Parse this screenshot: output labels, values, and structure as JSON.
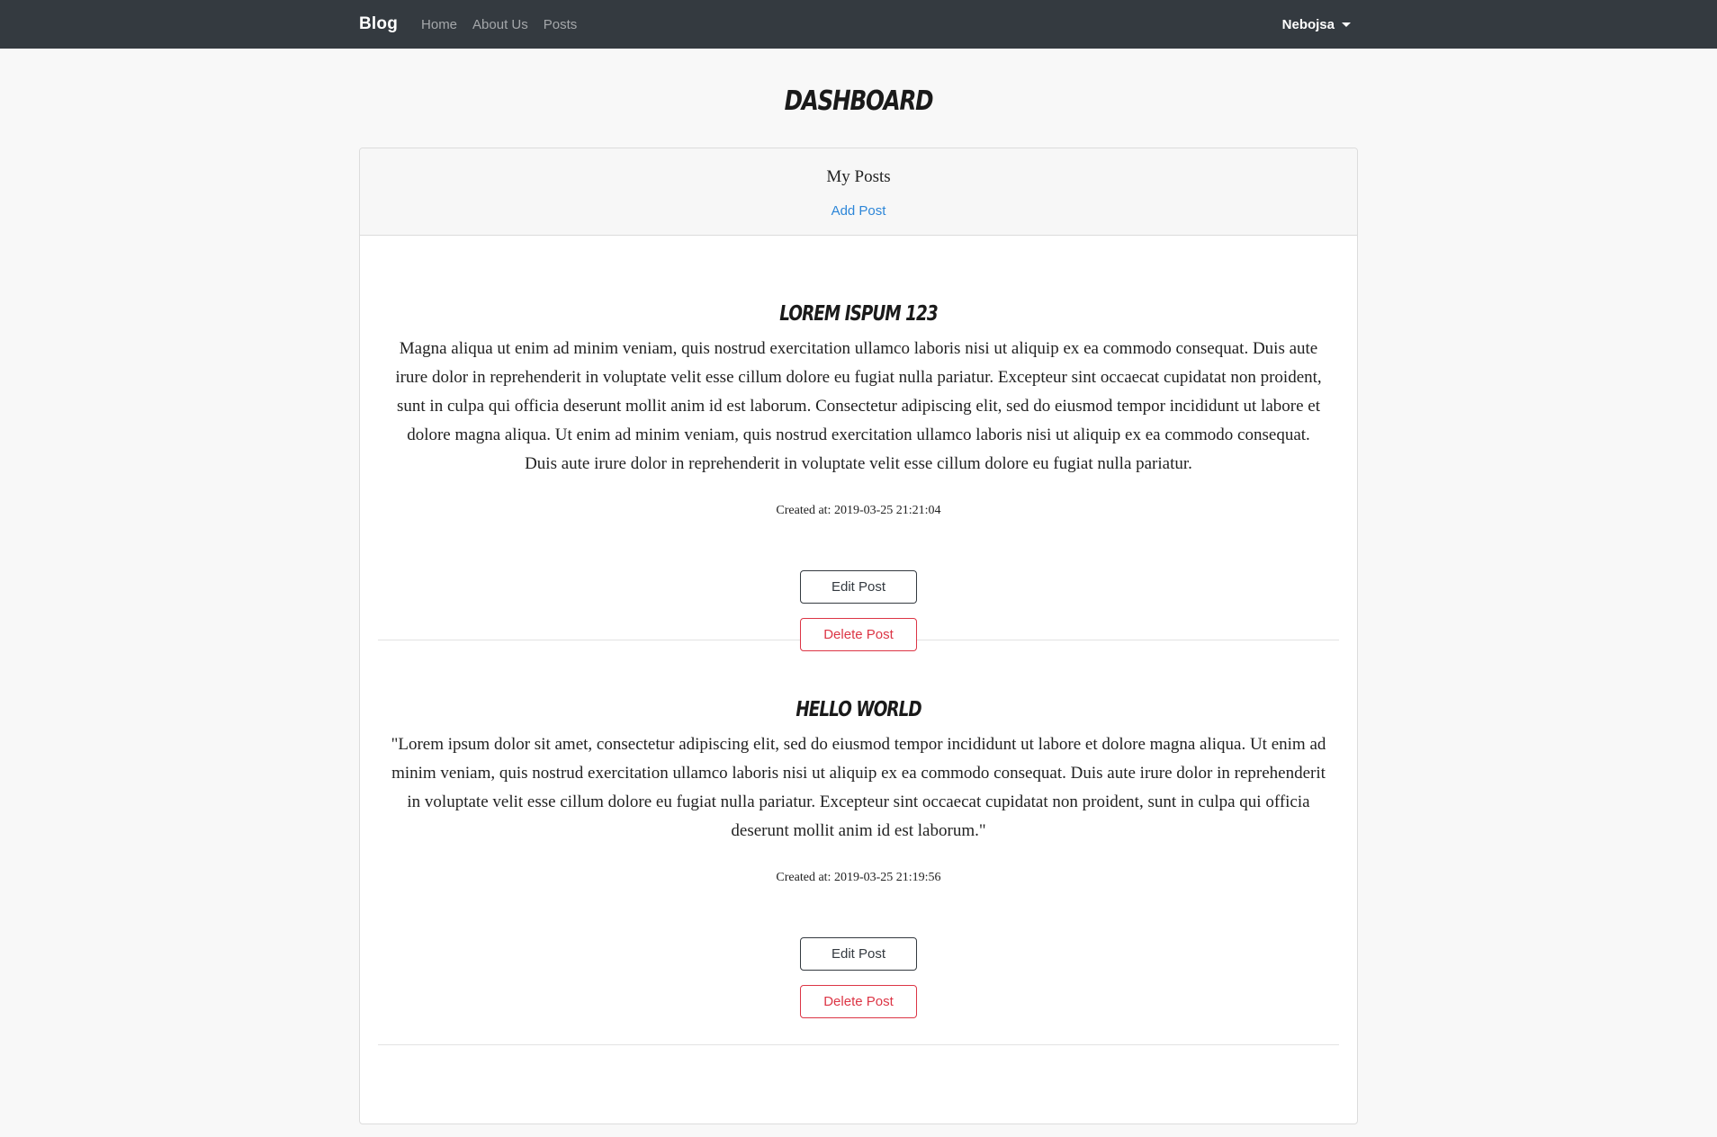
{
  "navbar": {
    "brand": "Blog",
    "links": [
      "Home",
      "About Us",
      "Posts"
    ],
    "user": "Nebojsa"
  },
  "page": {
    "title": "DASHBOARD"
  },
  "card": {
    "title": "My Posts",
    "add_label": "Add Post"
  },
  "posts": [
    {
      "title": "LOREM ISPUM 123",
      "body": "Magna aliqua ut enim ad minim veniam, quis nostrud exercitation ullamco laboris nisi ut aliquip ex ea commodo consequat. Duis aute irure dolor in reprehenderit in voluptate velit esse cillum dolore eu fugiat nulla pariatur. Excepteur sint occaecat cupidatat non proident, sunt in culpa qui officia deserunt mollit anim id est laborum. Consectetur adipiscing elit, sed do eiusmod tempor incididunt ut labore et dolore magna aliqua. Ut enim ad minim veniam, quis nostrud exercitation ullamco laboris nisi ut aliquip ex ea commodo consequat. Duis aute irure dolor in reprehenderit in voluptate velit esse cillum dolore eu fugiat nulla pariatur.",
      "created": "Created at: 2019-03-25 21:21:04",
      "edit_label": "Edit Post",
      "delete_label": "Delete Post"
    },
    {
      "title": "HELLO WORLD",
      "body": "\"Lorem ipsum dolor sit amet, consectetur adipiscing elit, sed do eiusmod tempor incididunt ut labore et dolore magna aliqua. Ut enim ad minim veniam, quis nostrud exercitation ullamco laboris nisi ut aliquip ex ea commodo consequat. Duis aute irure dolor in reprehenderit in voluptate velit esse cillum dolore eu fugiat nulla pariatur. Excepteur sint occaecat cupidatat non proident, sunt in culpa qui officia deserunt mollit anim id est laborum.\"",
      "created": "Created at: 2019-03-25 21:19:56",
      "edit_label": "Edit Post",
      "delete_label": "Delete Post"
    }
  ],
  "colors": {
    "navbar_bg": "#343a40",
    "link_blue": "#2d86d8",
    "danger": "#dc3545"
  }
}
